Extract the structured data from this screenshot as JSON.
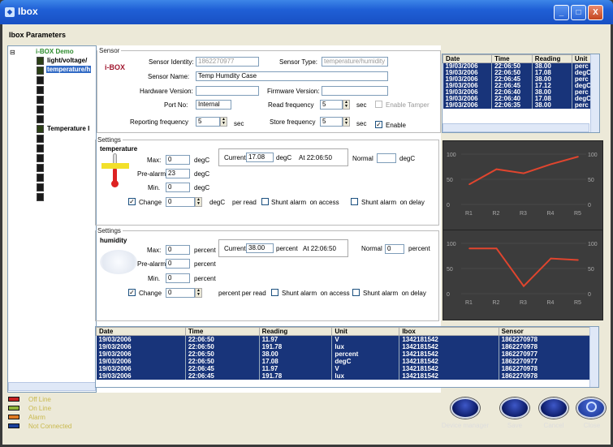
{
  "window": {
    "title": "Ibox",
    "minimize": "_",
    "maximize": "□",
    "close": "X"
  },
  "section_title": "Ibox Parameters",
  "tree": {
    "root": "i-BOX Demo",
    "items": [
      "light/voltage/",
      "temperature/h",
      "Temperature I"
    ]
  },
  "sensor": {
    "legend": "Sensor",
    "logo": "i-BOX",
    "identity_label": "Sensor Identity:",
    "identity_value": "1862270977",
    "type_label": "Sensor Type:",
    "type_value": "temperature/humidity",
    "name_label": "Sensor Name:",
    "name_value": "Temp Humdity Case",
    "hw_label": "Hardware Version:",
    "hw_value": "",
    "fw_label": "Firmware Version:",
    "fw_value": "",
    "port_label": "Port No:",
    "port_value": "Internal",
    "read_label": "Read frequency",
    "read_value": "5",
    "read_unit": "sec",
    "tamper_label": "Enable Tamper",
    "report_label": "Reporting frequency",
    "report_value": "5",
    "report_unit": "sec",
    "store_label": "Store frequency",
    "store_value": "5",
    "store_unit": "sec",
    "enable_label": "Enable"
  },
  "temp": {
    "legend": "Settings",
    "title": "temperature",
    "max_label": "Max:",
    "max_value": "0",
    "unit": "degC",
    "current_label": "Current",
    "current_value": "17.08",
    "at_label": "At 22:06:50",
    "normal_label": "Normal",
    "normal_value": "",
    "prealarm_label": "Pre-alarm",
    "prealarm_value": "23",
    "min_label": "Min.",
    "min_value": "0",
    "change_label": "Change",
    "change_value": "0",
    "perread": "degC    per read",
    "shunt_access": "Shunt alarm  on access",
    "shunt_delay": "Shunt alarm  on delay"
  },
  "hum": {
    "legend": "Settings",
    "title": "humidity",
    "max_label": "Max:",
    "max_value": "0",
    "unit": "percent",
    "current_label": "Current",
    "current_value": "38.00",
    "at_label": "At 22:06:50",
    "normal_label": "Normal",
    "normal_value": "0",
    "prealarm_label": "Pre-alarm",
    "prealarm_value": "0",
    "min_label": "Min.",
    "min_value": "0",
    "change_label": "Change",
    "change_value": "0",
    "perread": "percent per read",
    "shunt_access": "Shunt alarm  on access",
    "shunt_delay": "Shunt alarm  on delay"
  },
  "top_table": {
    "headers": [
      "Date",
      "Time",
      "Reading",
      "Unit"
    ],
    "rows": [
      [
        "19/03/2006",
        "22:06:50",
        "38.00",
        "perc"
      ],
      [
        "19/03/2006",
        "22:06:50",
        "17.08",
        "degC"
      ],
      [
        "19/03/2006",
        "22:06:45",
        "38.00",
        "perc"
      ],
      [
        "19/03/2006",
        "22:06:45",
        "17.12",
        "degC"
      ],
      [
        "19/03/2006",
        "22:06:40",
        "38.00",
        "perc"
      ],
      [
        "19/03/2006",
        "22:06:40",
        "17.08",
        "degC"
      ],
      [
        "19/03/2006",
        "22:06:35",
        "38.00",
        "perc"
      ]
    ]
  },
  "bottom_table": {
    "headers": [
      "Date",
      "Time",
      "Reading",
      "Unit",
      "Ibox",
      "Sensor"
    ],
    "rows": [
      [
        "19/03/2006",
        "22:06:50",
        "11.97",
        "V",
        "1342181542",
        "1862270978"
      ],
      [
        "19/03/2006",
        "22:06:50",
        "191.78",
        "lux",
        "1342181542",
        "1862270978"
      ],
      [
        "19/03/2006",
        "22:06:50",
        "38.00",
        "percent",
        "1342181542",
        "1862270977"
      ],
      [
        "19/03/2006",
        "22:06:50",
        "17.08",
        "degC",
        "1342181542",
        "1862270977"
      ],
      [
        "19/03/2006",
        "22:06:45",
        "11.97",
        "V",
        "1342181542",
        "1862270978"
      ],
      [
        "19/03/2006",
        "22:06:45",
        "191.78",
        "lux",
        "1342181542",
        "1862270978"
      ]
    ]
  },
  "chart_data": [
    {
      "type": "line",
      "categories": [
        "R1",
        "R2",
        "R3",
        "R4",
        "R5"
      ],
      "values": [
        40,
        70,
        62,
        80,
        95
      ],
      "ylim": [
        0,
        100
      ],
      "yticks": [
        "100",
        "50",
        "0"
      ],
      "color": "#e0452e"
    },
    {
      "type": "line",
      "categories": [
        "R1",
        "R2",
        "R3",
        "R4",
        "R5"
      ],
      "values": [
        90,
        90,
        15,
        70,
        67
      ],
      "ylim": [
        0,
        100
      ],
      "yticks": [
        "100",
        "50",
        "0"
      ],
      "color": "#e0452e"
    }
  ],
  "status_legend": [
    {
      "label": "Off Line",
      "color": "#c62020"
    },
    {
      "label": "On Line",
      "color": "#8fb53a"
    },
    {
      "label": "Alarm",
      "color": "#e07a22"
    },
    {
      "label": "Not Connected",
      "color": "#1a3f9a"
    }
  ],
  "buttons": {
    "device_manager": "Device manager",
    "save": "Save",
    "cancel": "Cancel",
    "close": "Close"
  },
  "colors": {
    "title_bar": "#1f5fd6",
    "row_bg": "#18347a",
    "chart_line": "#e0452e"
  }
}
